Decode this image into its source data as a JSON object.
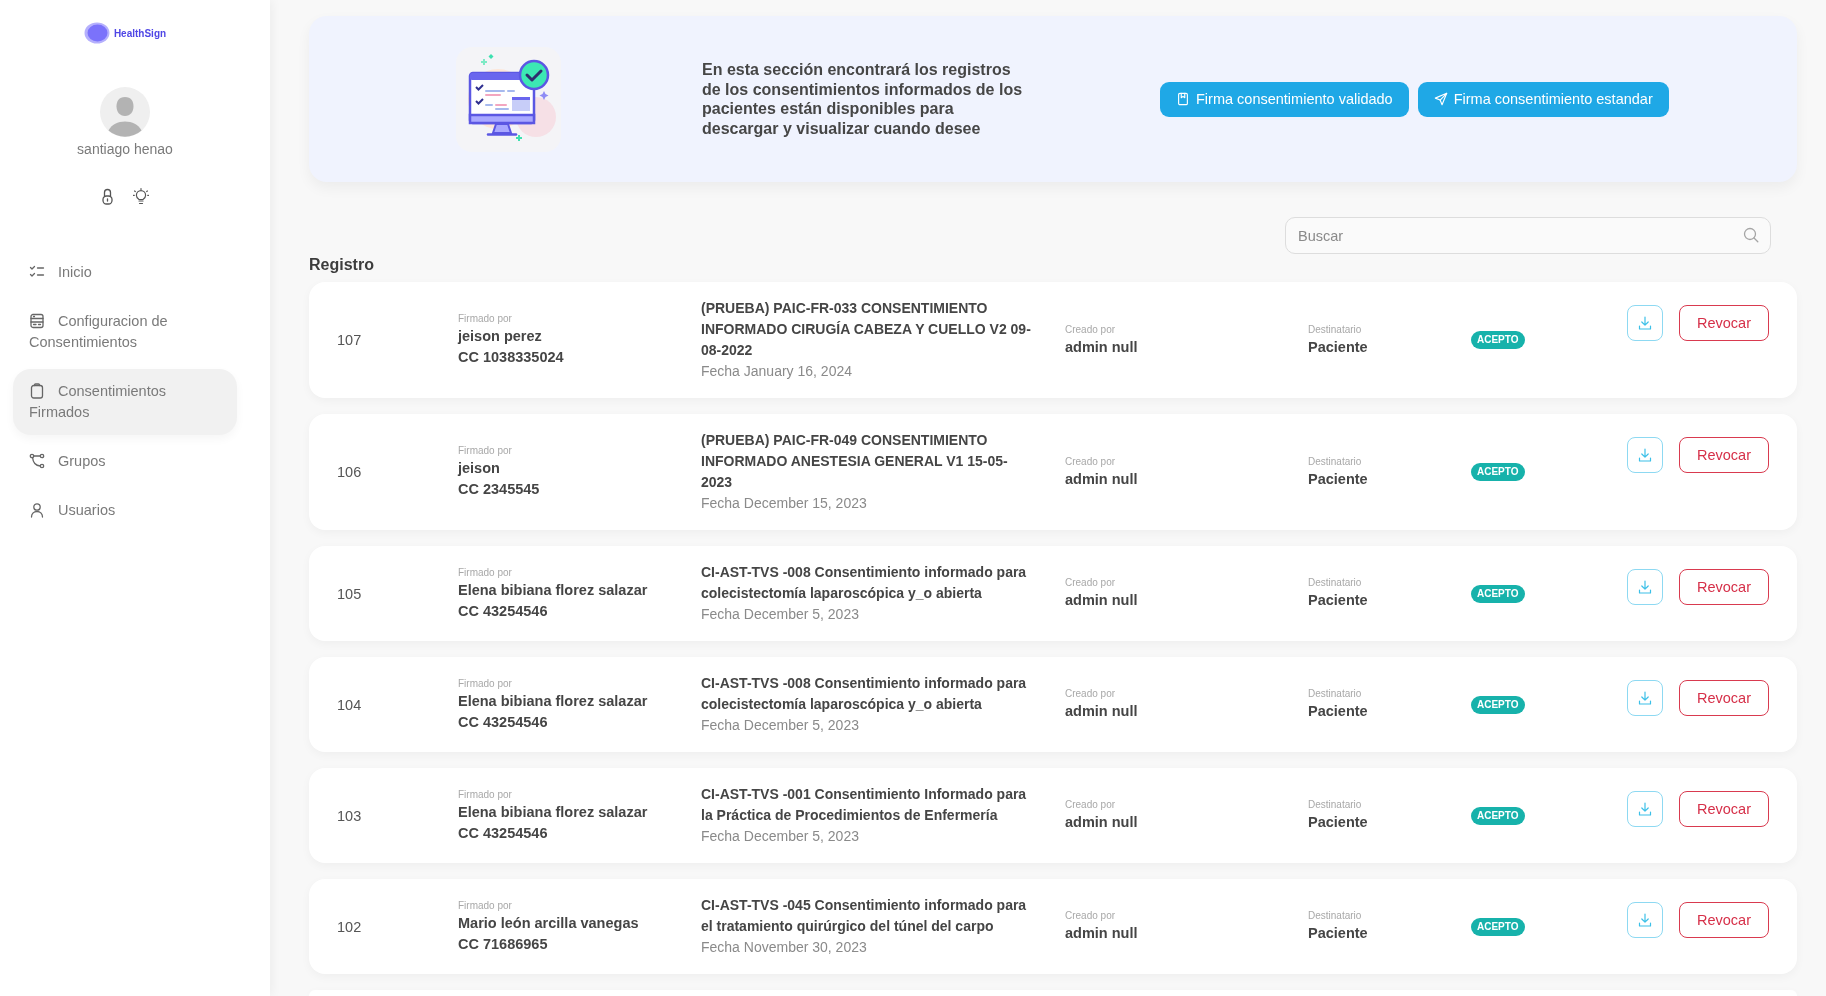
{
  "sidebar": {
    "logo": "HealthSign",
    "user_name": "santiago henao",
    "menu": [
      {
        "label": "Inicio",
        "selected": false
      },
      {
        "label": "Configuracion de Consentimientos",
        "selected": false
      },
      {
        "label": "Consentimientos Firmados",
        "selected": true
      },
      {
        "label": "Grupos",
        "selected": false
      },
      {
        "label": "Usuarios",
        "selected": false
      }
    ]
  },
  "banner": {
    "text": "En esta sección encontrará los registros de los consentimientos informados de los pacientes están disponibles para descargar y visualizar cuando desee",
    "buttons": [
      {
        "label": "Firma consentimiento validado"
      },
      {
        "label": "Firma consentimiento estandar"
      }
    ]
  },
  "search": {
    "placeholder": "Buscar"
  },
  "section_title": "Registro",
  "records": [
    {
      "number": "107",
      "signed_by_label": "Firmado por",
      "signer": "jeison perez",
      "signer_id": "CC 1038335024",
      "title": "(PRUEBA) PAIC-FR-033 CONSENTIMIENTO INFORMADO CIRUGÍA CABEZA Y CUELLO V2 09-08-2022",
      "date": "Fecha January 16, 2024",
      "created_by_label": "Creado por",
      "created_by": "admin null",
      "recipient_label": "Destinatario",
      "recipient": "Paciente",
      "status": "ACEPTO",
      "revoke_label": "Revocar"
    },
    {
      "number": "106",
      "signed_by_label": "Firmado por",
      "signer": "jeison",
      "signer_id": "CC 2345545",
      "title": "(PRUEBA) PAIC-FR-049 CONSENTIMIENTO INFORMADO ANESTESIA GENERAL V1 15-05-2023",
      "date": "Fecha December 15, 2023",
      "created_by_label": "Creado por",
      "created_by": "admin null",
      "recipient_label": "Destinatario",
      "recipient": "Paciente",
      "status": "ACEPTO",
      "revoke_label": "Revocar"
    },
    {
      "number": "105",
      "signed_by_label": "Firmado por",
      "signer": "Elena bibiana florez salazar",
      "signer_id": "CC 43254546",
      "title": "CI-AST-TVS -008 Consentimiento informado para colecistectomía laparoscópica y_o abierta",
      "date": "Fecha December 5, 2023",
      "created_by_label": "Creado por",
      "created_by": "admin null",
      "recipient_label": "Destinatario",
      "recipient": "Paciente",
      "status": "ACEPTO",
      "revoke_label": "Revocar"
    },
    {
      "number": "104",
      "signed_by_label": "Firmado por",
      "signer": "Elena bibiana florez salazar",
      "signer_id": "CC 43254546",
      "title": "CI-AST-TVS -008 Consentimiento informado para colecistectomía laparoscópica y_o abierta",
      "date": "Fecha December 5, 2023",
      "created_by_label": "Creado por",
      "created_by": "admin null",
      "recipient_label": "Destinatario",
      "recipient": "Paciente",
      "status": "ACEPTO",
      "revoke_label": "Revocar"
    },
    {
      "number": "103",
      "signed_by_label": "Firmado por",
      "signer": "Elena bibiana florez salazar",
      "signer_id": "CC 43254546",
      "title": "CI-AST-TVS -001 Consentimiento Informado para la Práctica de Procedimientos de Enfermería",
      "date": "Fecha December 5, 2023",
      "created_by_label": "Creado por",
      "created_by": "admin null",
      "recipient_label": "Destinatario",
      "recipient": "Paciente",
      "status": "ACEPTO",
      "revoke_label": "Revocar"
    },
    {
      "number": "102",
      "signed_by_label": "Firmado por",
      "signer": "Mario león arcilla vanegas",
      "signer_id": "CC 71686965",
      "title": "CI-AST-TVS -045 Consentimiento informado para el tratamiento quirúrgico del túnel del carpo",
      "date": "Fecha November 30, 2023",
      "created_by_label": "Creado por",
      "created_by": "admin null",
      "recipient_label": "Destinatario",
      "recipient": "Paciente",
      "status": "ACEPTO",
      "revoke_label": "Revocar"
    }
  ]
}
